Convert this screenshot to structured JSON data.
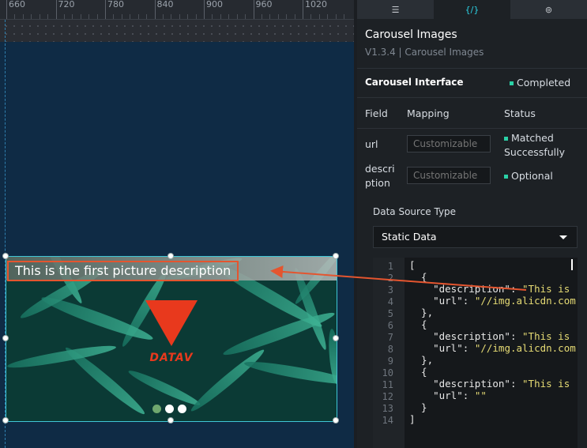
{
  "ruler": {
    "labels": [
      "660",
      "720",
      "780",
      "840",
      "900",
      "960",
      "1020"
    ]
  },
  "canvas": {
    "carousel": {
      "caption": "This is the first picture description",
      "logo_text": "DATAV",
      "indicator_dots": 3,
      "active_dot": 1
    }
  },
  "panel": {
    "tabs": [
      {
        "name": "settings-icon",
        "glyph": "☰"
      },
      {
        "name": "code-icon",
        "glyph": "{/}"
      },
      {
        "name": "interaction-icon",
        "glyph": "⊚"
      }
    ],
    "title": "Carousel Images",
    "subtitle": "V1.3.4 | Carousel Images",
    "interface_label": "Carousel Interface",
    "interface_status": "Completed",
    "columns": {
      "field": "Field",
      "mapping": "Mapping",
      "status": "Status"
    },
    "fields": [
      {
        "name": "url",
        "placeholder": "Customizable",
        "status_line1": "Matched",
        "status_line2": "Successfully"
      },
      {
        "name_line1": "descri",
        "name_line2": "ption",
        "placeholder": "Customizable",
        "status": "Optional"
      }
    ],
    "data_source_label": "Data Source Type",
    "data_source_value": "Static Data",
    "code_line_numbers": [
      "1",
      "2",
      "3",
      "4",
      "5",
      "6",
      "7",
      "8",
      "9",
      "10",
      "11",
      "12",
      "13",
      "14"
    ],
    "code_lines": [
      "[",
      "  {",
      "    \"description\": \"This is",
      "    \"url\": \"//img.alicdn.com",
      "  },",
      "  {",
      "    \"description\": \"This is",
      "    \"url\": \"//img.alicdn.com",
      "  },",
      "  {",
      "    \"description\": \"This is",
      "    \"url\": \"\"",
      "  }",
      "]"
    ]
  },
  "colors": {
    "accent": "#2bd3e6",
    "status_green": "#2ad1a6",
    "annotation_red": "#e4552f",
    "canvas_bg": "#0f2b45"
  }
}
